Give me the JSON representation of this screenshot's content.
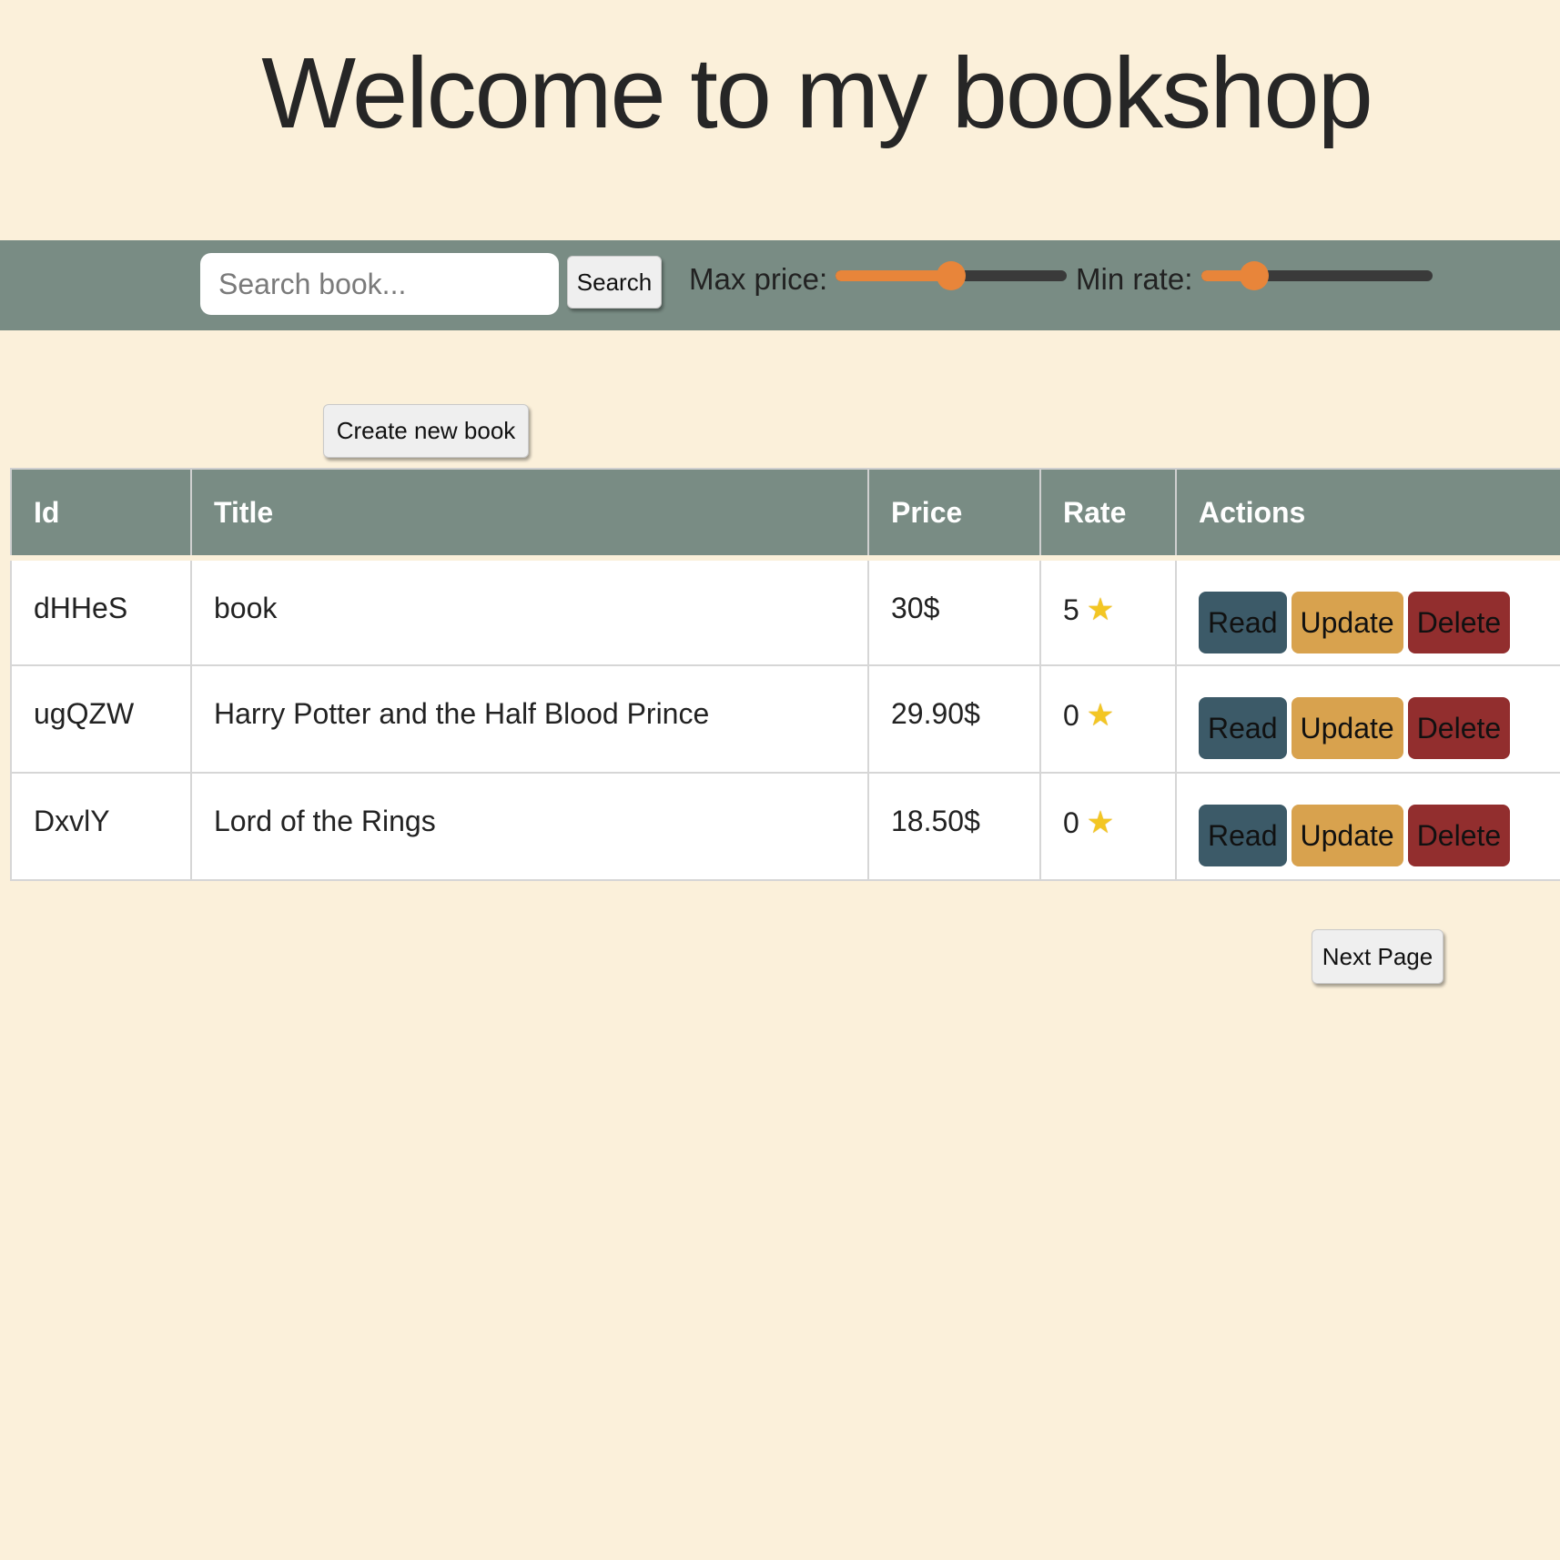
{
  "header": {
    "title": "Welcome to my bookshop"
  },
  "toolbar": {
    "search_placeholder": "Search book...",
    "search_value": "",
    "search_label": "Search",
    "max_price_label": "Max price:",
    "max_price_fraction": 0.5,
    "min_rate_label": "Min rate:",
    "min_rate_fraction": 0.23,
    "accent_color": "#e8853a"
  },
  "actions": {
    "create_label": "Create new book",
    "next_page_label": "Next Page"
  },
  "table": {
    "columns": [
      "Id",
      "Title",
      "Price",
      "Rate",
      "Actions"
    ],
    "rows": [
      {
        "id": "dHHeS",
        "title": "book",
        "price": "30$",
        "rate": "5"
      },
      {
        "id": "ugQZW",
        "title": "Harry Potter and the Half Blood Prince",
        "price": "29.90$",
        "rate": "0"
      },
      {
        "id": "DxvlY",
        "title": "Lord of the Rings",
        "price": "18.50$",
        "rate": "0"
      }
    ],
    "row_actions": {
      "read": "Read",
      "update": "Update",
      "delete": "Delete"
    },
    "rate_icon": "star-icon"
  },
  "colors": {
    "background": "#fbf0da",
    "bar": "#798c84",
    "read": "#3c5a68",
    "update": "#d8a24e",
    "delete": "#922e2e"
  }
}
